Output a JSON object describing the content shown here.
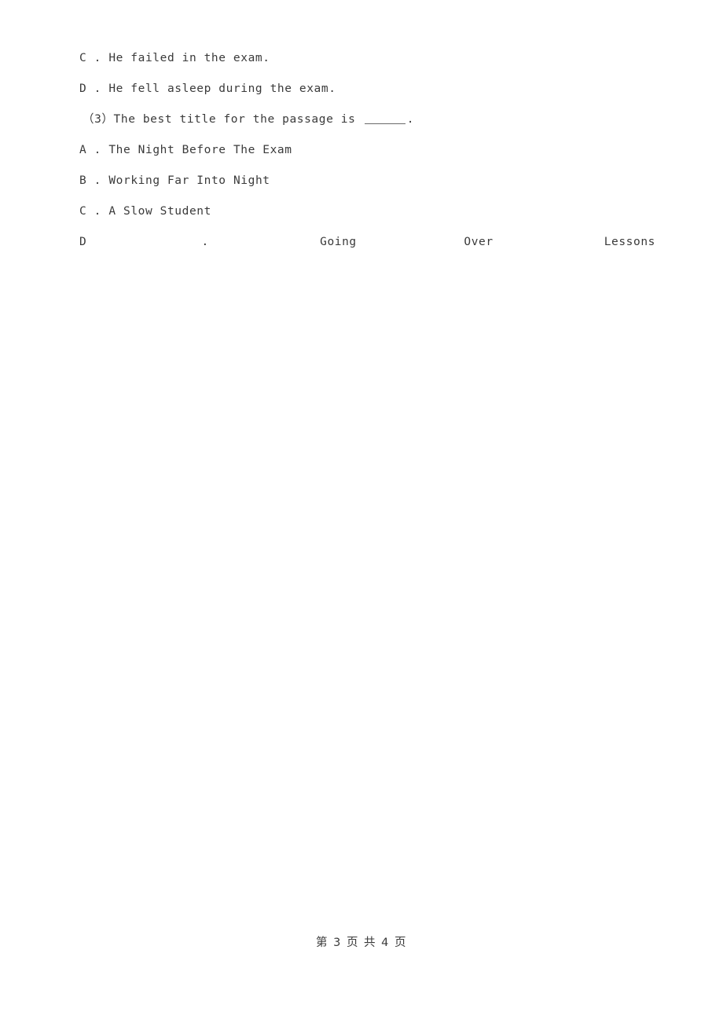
{
  "document": {
    "type": "exam-worksheet-page",
    "background_color": "#ffffff",
    "text_color": "#3a3a3a"
  },
  "content": {
    "lines": [
      {
        "id": "option-c-prev",
        "text": "C . He failed in the exam."
      },
      {
        "id": "option-d-prev",
        "text": "D . He fell asleep during the exam."
      }
    ],
    "question": {
      "number": "（3）",
      "stem_before_blank": "The best title for the passage is ",
      "blank": "______",
      "stem_after_blank": "."
    },
    "options": [
      {
        "label": "A",
        "separator": " . ",
        "text": "The Night Before The Exam"
      },
      {
        "label": "B",
        "separator": " . ",
        "text": "Working Far Into Night"
      },
      {
        "label": "C",
        "separator": " . ",
        "text": "A Slow Student"
      }
    ],
    "option_d_justified": {
      "label": "D",
      "separator": ".",
      "word1": "Going",
      "word2": "Over",
      "word3": "Lessons"
    }
  },
  "footer": {
    "text": "第 3 页 共 4 页",
    "current_page": "3",
    "total_pages": "4"
  }
}
